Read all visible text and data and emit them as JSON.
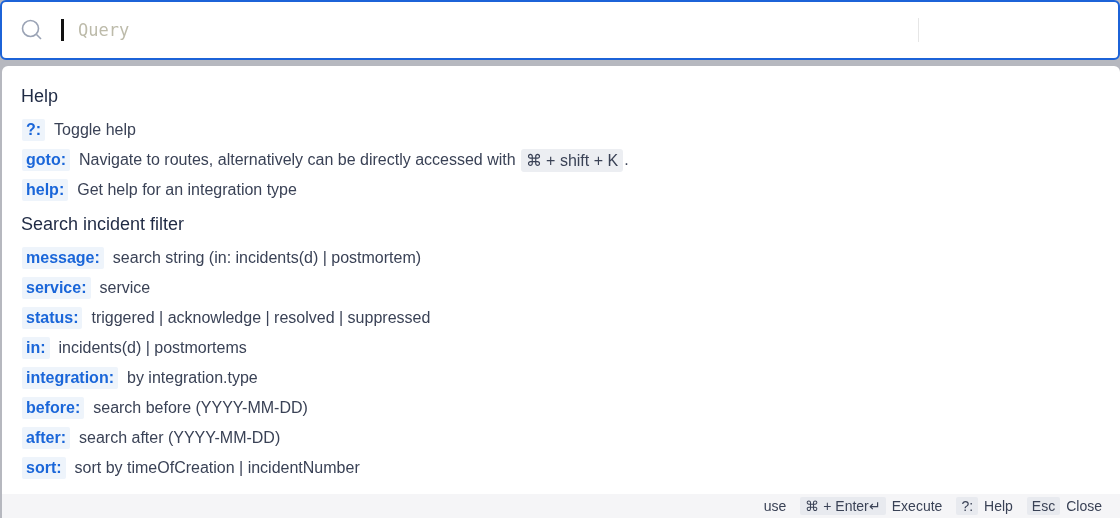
{
  "search": {
    "placeholder": "Query"
  },
  "sections": [
    {
      "title": "Help",
      "items": [
        {
          "key": "?:",
          "text": "Toggle help"
        },
        {
          "key": "goto:",
          "text": "Navigate to routes, alternatively can be directly accessed with",
          "shortcut": "⌘ + shift + K",
          "suffix": "."
        },
        {
          "key": "help:",
          "text": "Get help for an integration type"
        }
      ]
    },
    {
      "title": "Search incident filter",
      "items": [
        {
          "key": "message:",
          "text": "search string (in: incidents(d) | postmortem)"
        },
        {
          "key": "service:",
          "text": "service"
        },
        {
          "key": "status:",
          "text": "triggered | acknowledge | resolved | suppressed"
        },
        {
          "key": "in:",
          "text": "incidents(d) | postmortems"
        },
        {
          "key": "integration:",
          "text": "by integration.type"
        },
        {
          "key": "before:",
          "text": "search before (YYYY-MM-DD)"
        },
        {
          "key": "after:",
          "text": "search after (YYYY-MM-DD)"
        },
        {
          "key": "sort:",
          "text": "sort by timeOfCreation | incidentNumber"
        }
      ]
    }
  ],
  "footer": {
    "label": "use",
    "shortcuts": [
      {
        "key": "⌘ + Enter↵",
        "action": "Execute"
      },
      {
        "key": "?:",
        "action": "Help"
      },
      {
        "key": "Esc",
        "action": "Close"
      }
    ]
  }
}
